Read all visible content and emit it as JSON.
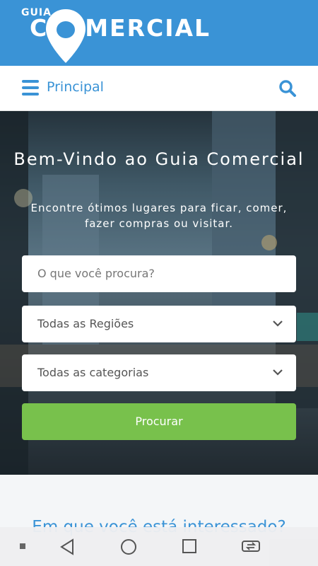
{
  "header": {
    "logo_small": "GUIA",
    "logo_big_first": "C",
    "logo_big_rest": "MERCIAL",
    "logo_icon": "map-pin-icon",
    "brand_color": "#3a93d6"
  },
  "nav": {
    "menu_icon": "hamburger-menu-icon",
    "label": "Principal",
    "search_icon": "search-icon"
  },
  "hero": {
    "title": "Bem-Vindo ao Guia Comercial",
    "subtitle": "Encontre ótimos lugares para ficar, comer, fazer compras ou visitar.",
    "search_placeholder": "O que você procura?",
    "region_select": "Todas as Regiões",
    "category_select": "Todas as categorias",
    "submit_label": "Procurar",
    "submit_color": "#78c14c"
  },
  "section": {
    "heading": "Em que você está interessado?"
  },
  "system_nav": {
    "icons": [
      "dot-icon",
      "back-icon",
      "home-icon",
      "recents-icon",
      "switch-apps-icon"
    ]
  }
}
